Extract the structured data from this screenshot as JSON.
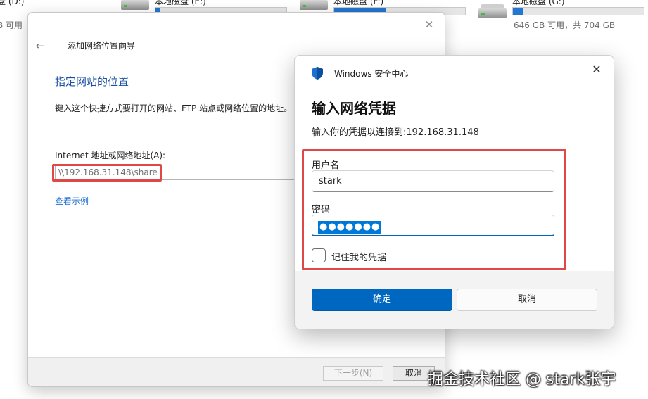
{
  "explorer": {
    "drives": [
      {
        "name": "本地磁盘 (D:)",
        "free_text": "B 可用",
        "fill_percent": 0
      },
      {
        "name": "本地磁盘 (E:)",
        "free_text": "",
        "fill_percent": 3
      },
      {
        "name": "本地磁盘 (F:)",
        "free_text": "",
        "fill_percent": 40
      },
      {
        "name": "本地磁盘 (G:)",
        "free_text": "646 GB 可用，共 704 GB",
        "fill_percent": 8
      }
    ]
  },
  "wizard": {
    "title": "添加网络位置向导",
    "heading": "指定网站的位置",
    "description": "键入这个快捷方式要打开的网站、FTP 站点或网络位置的地址。",
    "address_label": "Internet 地址或网络地址(A):",
    "address_value": "\\\\192.168.31.148\\share",
    "example_link": "查看示例",
    "next_button": "下一步(N)",
    "cancel_button": "取消"
  },
  "security": {
    "app_title": "Windows 安全中心",
    "heading": "输入网络凭据",
    "subtitle": "输入你的凭据以连接到:192.168.31.148",
    "username_label": "用户名",
    "username_value": "stark",
    "password_label": "密码",
    "password_mask": "●●●●●●●",
    "remember_label": "记住我的凭据",
    "remember_checked": false,
    "ok_button": "确定",
    "cancel_button": "取消",
    "accent_color": "#0067c0",
    "highlight_color": "#e04848"
  },
  "watermark": "掘金技术社区 @ stark张宇"
}
